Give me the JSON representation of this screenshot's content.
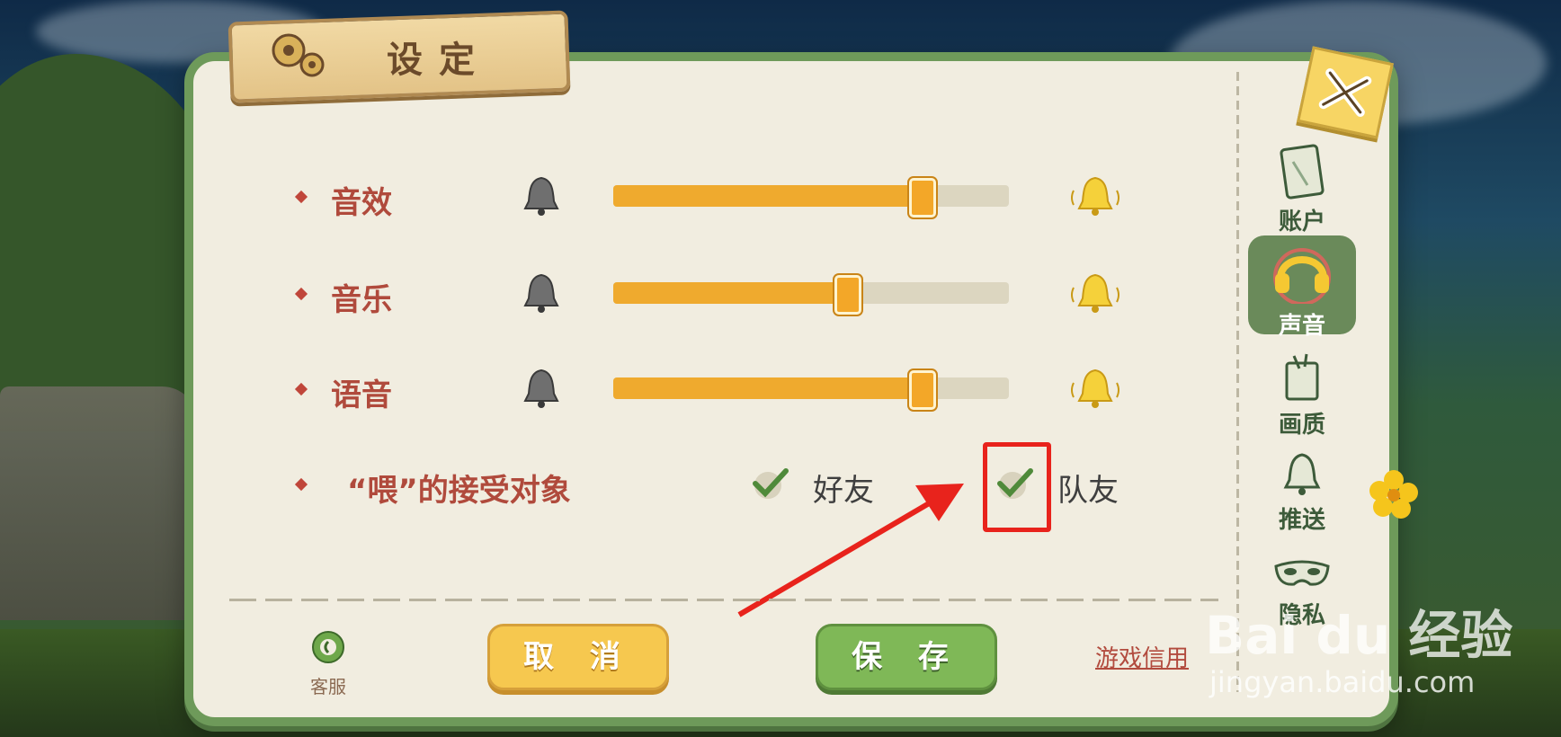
{
  "title": "设定",
  "rows": [
    {
      "label": "音效",
      "level": 0.78
    },
    {
      "label": "音乐",
      "level": 0.59
    },
    {
      "label": "语音",
      "level": 0.78
    }
  ],
  "recipients": {
    "label": "“喂”的接受对象",
    "friend_label": "好友",
    "friend_checked": true,
    "teammate_label": "队友",
    "teammate_checked": true
  },
  "bottom": {
    "support_label": "客服",
    "cancel_label": "取 消",
    "save_label": "保 存",
    "link_label": "游戏信用"
  },
  "tabs": [
    {
      "label": "账户",
      "icon": "card-icon",
      "active": false
    },
    {
      "label": "声音",
      "icon": "headphones-icon",
      "active": true
    },
    {
      "label": "画质",
      "icon": "picture-icon",
      "active": false
    },
    {
      "label": "推送",
      "icon": "bell-icon",
      "active": false
    },
    {
      "label": "隐私",
      "icon": "mask-icon",
      "active": false
    }
  ],
  "watermark": {
    "brand": "Bai du 经验",
    "url": "jingyan.baidu.com"
  },
  "colors": {
    "accent": "#efaa2e",
    "panel_border": "#6e9a5a",
    "label": "#b04a3c",
    "highlight": "#e8231c"
  }
}
